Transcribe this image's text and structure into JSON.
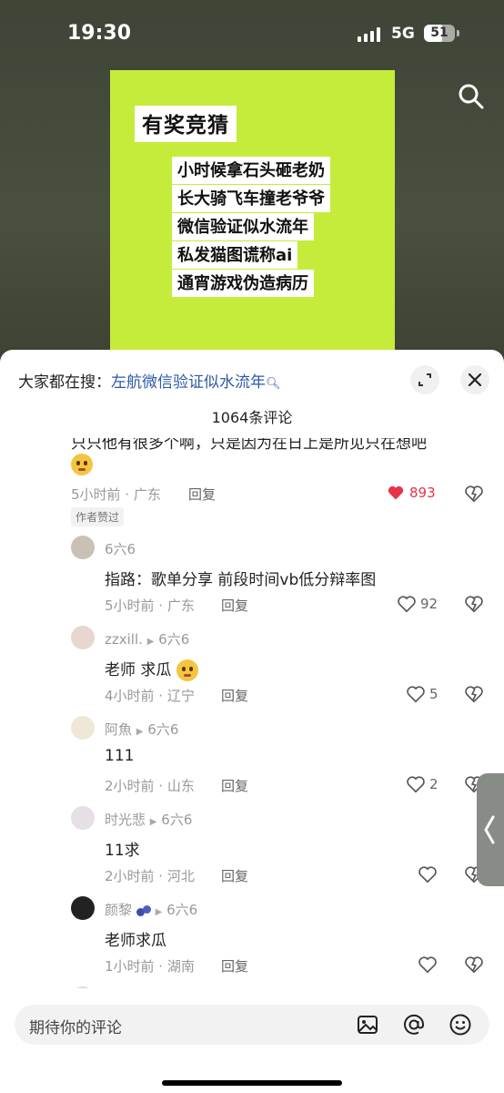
{
  "status_bar": {
    "time": "19:30",
    "network": "5G",
    "battery": "51"
  },
  "video": {
    "poster_title": "有奖竞猜",
    "poster_lines": [
      "小时候拿石头砸老奶",
      "长大骑飞车撞老爷爷",
      "微信验证似水流年",
      "私发猫图谎称ai",
      "通宵游戏伪造病历"
    ],
    "search_icon": "search-icon"
  },
  "comments_panel": {
    "hot_search_prefix": "大家都在搜：",
    "hot_search_keyword": "左航微信验证似水流年",
    "comment_count": "1064条评论",
    "top_comment": {
      "partial_text": "只只他有很多个啊，只是因为在日上是所见只在想吧",
      "meta": "5小时前 · 广东",
      "reply": "回复",
      "likes": "893",
      "badge": "作者赞过"
    },
    "replies": [
      {
        "user": "6六6",
        "reply_to": "",
        "text": "指路：歌单分享 前段时间vb低分辩率图",
        "meta": "5小时前 · 广东",
        "reply": "回复",
        "likes": "92"
      },
      {
        "user": "zzxill.",
        "reply_to": "6六6",
        "text": "老师 求瓜",
        "meta": "4小时前 · 辽宁",
        "reply": "回复",
        "likes": "5"
      },
      {
        "user": "阿魚",
        "reply_to": "6六6",
        "text": "111",
        "meta": "2小时前 · 山东",
        "reply": "回复",
        "likes": "2"
      },
      {
        "user": "时光悲",
        "reply_to": "6六6",
        "text": "11求",
        "meta": "2小时前 · 河北",
        "reply": "回复",
        "likes": ""
      },
      {
        "user": "颜黎",
        "reply_to": "6六6",
        "text": "老师求瓜",
        "meta": "1小时前 · 湖南",
        "reply": "回复",
        "likes": ""
      }
    ]
  },
  "input": {
    "placeholder": "期待你的评论"
  },
  "colors": {
    "poster_bg": "#c5ec3a",
    "link_blue": "#2b5aa4",
    "like_red": "#e8324a"
  }
}
